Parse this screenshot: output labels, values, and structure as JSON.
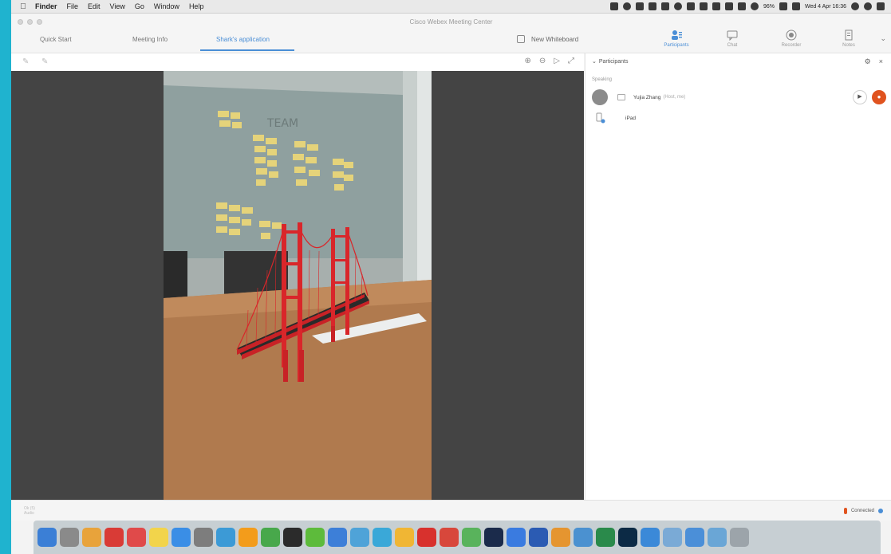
{
  "menubar": {
    "app": "Finder",
    "menus": [
      "File",
      "Edit",
      "View",
      "Go",
      "Window",
      "Help"
    ],
    "battery": "96%",
    "datetime": "Wed 4 Apr 16:36"
  },
  "window": {
    "title": "Cisco Webex Meeting Center"
  },
  "tabs": [
    {
      "label": "Quick Start",
      "active": false
    },
    {
      "label": "Meeting Info",
      "active": false
    },
    {
      "label": "Shark's application",
      "active": true
    }
  ],
  "toolbar": {
    "new_whiteboard": "New Whiteboard",
    "participants": "Participants",
    "chat": "Chat",
    "recorder": "Recorder",
    "notes": "Notes"
  },
  "panel": {
    "title": "Participants",
    "section": "Speaking",
    "participants": [
      {
        "name": "Yujia Zhang",
        "role": "(Host, me)",
        "avatar_color": "#8b8b8b"
      },
      {
        "name": "iPad",
        "role": "",
        "avatar_color": ""
      }
    ]
  },
  "statusbar": {
    "connected": "Connected",
    "left_info_line1": "Ok (5)",
    "left_info_line2": "Audio"
  },
  "colors": {
    "accent": "#4a8ed6",
    "mute": "#e0531f",
    "desktop": "#1fb3cf",
    "share_bg": "#444444",
    "bridge": "#d9262a"
  },
  "dock": {
    "apps": [
      {
        "icon": "finder-icon",
        "color": "#3b7fd6"
      },
      {
        "icon": "launchpad-icon",
        "color": "#8a8a8a"
      },
      {
        "icon": "safari-icon",
        "color": "#e8a33b"
      },
      {
        "icon": "calendar-icon",
        "color": "#d93b36"
      },
      {
        "icon": "photos-icon",
        "color": "#e04a4a"
      },
      {
        "icon": "notes-icon",
        "color": "#f2d44b"
      },
      {
        "icon": "appstore-icon",
        "color": "#3a8ee6"
      },
      {
        "icon": "system-preferences-icon",
        "color": "#7d7d7d"
      },
      {
        "icon": "qq-icon",
        "color": "#3c9ad6"
      },
      {
        "icon": "pages-icon",
        "color": "#f39c1b"
      },
      {
        "icon": "numbers-icon",
        "color": "#48a84b"
      },
      {
        "icon": "chat-icon",
        "color": "#2b2b2b"
      },
      {
        "icon": "wechat-icon",
        "color": "#5dbb3b"
      },
      {
        "icon": "tweak-icon",
        "color": "#3d7fd8"
      },
      {
        "icon": "trash-app-icon",
        "color": "#4fa3d8"
      },
      {
        "icon": "xcode-icon",
        "color": "#3aa8d8"
      },
      {
        "icon": "sketch-icon",
        "color": "#f0b634"
      },
      {
        "icon": "netease-icon",
        "color": "#d8312d"
      },
      {
        "icon": "chrome-icon",
        "color": "#d8473b"
      },
      {
        "icon": "maps-icon",
        "color": "#59b35c"
      },
      {
        "icon": "webex-icon",
        "color": "#1b2b4b"
      },
      {
        "icon": "webstorm-icon",
        "color": "#3a7be0"
      },
      {
        "icon": "word-icon",
        "color": "#2b5bb3"
      },
      {
        "icon": "sequel-icon",
        "color": "#e59530"
      },
      {
        "icon": "wechat-work-icon",
        "color": "#4b91d0"
      },
      {
        "icon": "excel-icon",
        "color": "#2a8a4b"
      },
      {
        "icon": "photoshop-icon",
        "color": "#0c2a45"
      },
      {
        "icon": "app-store-blue-icon",
        "color": "#3b89d8"
      },
      {
        "icon": "preview-icon",
        "color": "#7aaad6"
      },
      {
        "icon": "vscode-icon",
        "color": "#4b8fd8"
      },
      {
        "icon": "downloads-icon",
        "color": "#6aa6d6"
      },
      {
        "icon": "trash-icon",
        "color": "#9ca4aa"
      }
    ]
  }
}
